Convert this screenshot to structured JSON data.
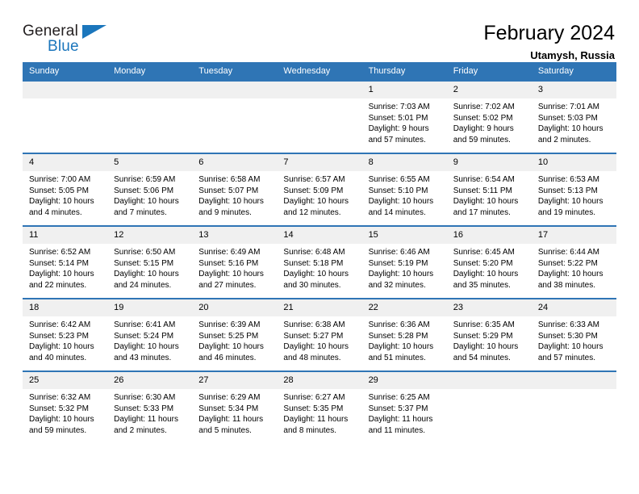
{
  "brand": {
    "name_part1": "General",
    "name_part2": "Blue",
    "flag_icon": "triangle-flag-icon"
  },
  "header": {
    "title": "February 2024",
    "location": "Utamysh, Russia"
  },
  "theme": {
    "header_blue": "#2f75b5",
    "brand_blue": "#1b76bc",
    "daynum_gray": "#f0f0f0",
    "text_black": "#000000"
  },
  "calendar": {
    "weekday_headers": [
      "Sunday",
      "Monday",
      "Tuesday",
      "Wednesday",
      "Thursday",
      "Friday",
      "Saturday"
    ],
    "weeks": [
      [
        {
          "day": "",
          "lines": []
        },
        {
          "day": "",
          "lines": []
        },
        {
          "day": "",
          "lines": []
        },
        {
          "day": "",
          "lines": []
        },
        {
          "day": "1",
          "lines": [
            "Sunrise: 7:03 AM",
            "Sunset: 5:01 PM",
            "Daylight: 9 hours",
            "and 57 minutes."
          ]
        },
        {
          "day": "2",
          "lines": [
            "Sunrise: 7:02 AM",
            "Sunset: 5:02 PM",
            "Daylight: 9 hours",
            "and 59 minutes."
          ]
        },
        {
          "day": "3",
          "lines": [
            "Sunrise: 7:01 AM",
            "Sunset: 5:03 PM",
            "Daylight: 10 hours",
            "and 2 minutes."
          ]
        }
      ],
      [
        {
          "day": "4",
          "lines": [
            "Sunrise: 7:00 AM",
            "Sunset: 5:05 PM",
            "Daylight: 10 hours",
            "and 4 minutes."
          ]
        },
        {
          "day": "5",
          "lines": [
            "Sunrise: 6:59 AM",
            "Sunset: 5:06 PM",
            "Daylight: 10 hours",
            "and 7 minutes."
          ]
        },
        {
          "day": "6",
          "lines": [
            "Sunrise: 6:58 AM",
            "Sunset: 5:07 PM",
            "Daylight: 10 hours",
            "and 9 minutes."
          ]
        },
        {
          "day": "7",
          "lines": [
            "Sunrise: 6:57 AM",
            "Sunset: 5:09 PM",
            "Daylight: 10 hours",
            "and 12 minutes."
          ]
        },
        {
          "day": "8",
          "lines": [
            "Sunrise: 6:55 AM",
            "Sunset: 5:10 PM",
            "Daylight: 10 hours",
            "and 14 minutes."
          ]
        },
        {
          "day": "9",
          "lines": [
            "Sunrise: 6:54 AM",
            "Sunset: 5:11 PM",
            "Daylight: 10 hours",
            "and 17 minutes."
          ]
        },
        {
          "day": "10",
          "lines": [
            "Sunrise: 6:53 AM",
            "Sunset: 5:13 PM",
            "Daylight: 10 hours",
            "and 19 minutes."
          ]
        }
      ],
      [
        {
          "day": "11",
          "lines": [
            "Sunrise: 6:52 AM",
            "Sunset: 5:14 PM",
            "Daylight: 10 hours",
            "and 22 minutes."
          ]
        },
        {
          "day": "12",
          "lines": [
            "Sunrise: 6:50 AM",
            "Sunset: 5:15 PM",
            "Daylight: 10 hours",
            "and 24 minutes."
          ]
        },
        {
          "day": "13",
          "lines": [
            "Sunrise: 6:49 AM",
            "Sunset: 5:16 PM",
            "Daylight: 10 hours",
            "and 27 minutes."
          ]
        },
        {
          "day": "14",
          "lines": [
            "Sunrise: 6:48 AM",
            "Sunset: 5:18 PM",
            "Daylight: 10 hours",
            "and 30 minutes."
          ]
        },
        {
          "day": "15",
          "lines": [
            "Sunrise: 6:46 AM",
            "Sunset: 5:19 PM",
            "Daylight: 10 hours",
            "and 32 minutes."
          ]
        },
        {
          "day": "16",
          "lines": [
            "Sunrise: 6:45 AM",
            "Sunset: 5:20 PM",
            "Daylight: 10 hours",
            "and 35 minutes."
          ]
        },
        {
          "day": "17",
          "lines": [
            "Sunrise: 6:44 AM",
            "Sunset: 5:22 PM",
            "Daylight: 10 hours",
            "and 38 minutes."
          ]
        }
      ],
      [
        {
          "day": "18",
          "lines": [
            "Sunrise: 6:42 AM",
            "Sunset: 5:23 PM",
            "Daylight: 10 hours",
            "and 40 minutes."
          ]
        },
        {
          "day": "19",
          "lines": [
            "Sunrise: 6:41 AM",
            "Sunset: 5:24 PM",
            "Daylight: 10 hours",
            "and 43 minutes."
          ]
        },
        {
          "day": "20",
          "lines": [
            "Sunrise: 6:39 AM",
            "Sunset: 5:25 PM",
            "Daylight: 10 hours",
            "and 46 minutes."
          ]
        },
        {
          "day": "21",
          "lines": [
            "Sunrise: 6:38 AM",
            "Sunset: 5:27 PM",
            "Daylight: 10 hours",
            "and 48 minutes."
          ]
        },
        {
          "day": "22",
          "lines": [
            "Sunrise: 6:36 AM",
            "Sunset: 5:28 PM",
            "Daylight: 10 hours",
            "and 51 minutes."
          ]
        },
        {
          "day": "23",
          "lines": [
            "Sunrise: 6:35 AM",
            "Sunset: 5:29 PM",
            "Daylight: 10 hours",
            "and 54 minutes."
          ]
        },
        {
          "day": "24",
          "lines": [
            "Sunrise: 6:33 AM",
            "Sunset: 5:30 PM",
            "Daylight: 10 hours",
            "and 57 minutes."
          ]
        }
      ],
      [
        {
          "day": "25",
          "lines": [
            "Sunrise: 6:32 AM",
            "Sunset: 5:32 PM",
            "Daylight: 10 hours",
            "and 59 minutes."
          ]
        },
        {
          "day": "26",
          "lines": [
            "Sunrise: 6:30 AM",
            "Sunset: 5:33 PM",
            "Daylight: 11 hours",
            "and 2 minutes."
          ]
        },
        {
          "day": "27",
          "lines": [
            "Sunrise: 6:29 AM",
            "Sunset: 5:34 PM",
            "Daylight: 11 hours",
            "and 5 minutes."
          ]
        },
        {
          "day": "28",
          "lines": [
            "Sunrise: 6:27 AM",
            "Sunset: 5:35 PM",
            "Daylight: 11 hours",
            "and 8 minutes."
          ]
        },
        {
          "day": "29",
          "lines": [
            "Sunrise: 6:25 AM",
            "Sunset: 5:37 PM",
            "Daylight: 11 hours",
            "and 11 minutes."
          ]
        },
        {
          "day": "",
          "lines": []
        },
        {
          "day": "",
          "lines": []
        }
      ]
    ]
  }
}
